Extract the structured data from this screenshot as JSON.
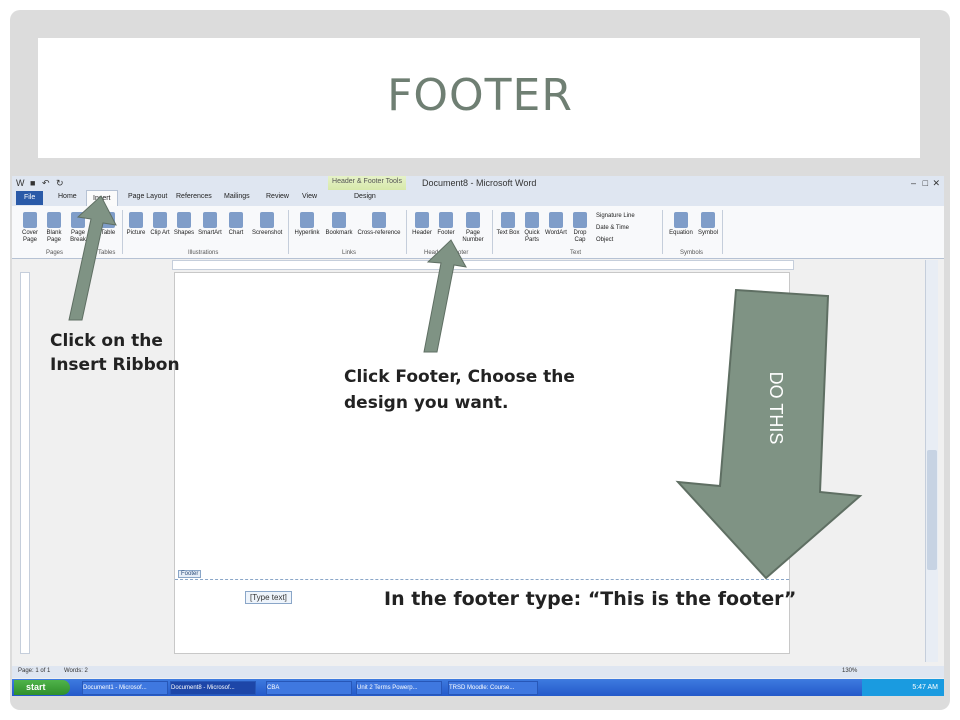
{
  "slide": {
    "title": "FOOTER"
  },
  "word": {
    "window_title": "Document8 - Microsoft Word",
    "contextual_tab": {
      "group": "Header & Footer Tools",
      "tab": "Design"
    },
    "tabs": [
      "File",
      "Home",
      "Insert",
      "Page Layout",
      "References",
      "Mailings",
      "Review",
      "View"
    ],
    "ribbon": {
      "buttons": [
        {
          "label": "Cover Page",
          "icon": "cover-page-icon"
        },
        {
          "label": "Blank Page",
          "icon": "blank-page-icon"
        },
        {
          "label": "Page Break",
          "icon": "page-break-icon"
        },
        {
          "label": "Table",
          "icon": "table-icon"
        },
        {
          "label": "Picture",
          "icon": "picture-icon"
        },
        {
          "label": "Clip Art",
          "icon": "clip-art-icon"
        },
        {
          "label": "Shapes",
          "icon": "shapes-icon"
        },
        {
          "label": "SmartArt",
          "icon": "smartart-icon"
        },
        {
          "label": "Chart",
          "icon": "chart-icon"
        },
        {
          "label": "Screenshot",
          "icon": "screenshot-icon"
        },
        {
          "label": "Hyperlink",
          "icon": "hyperlink-icon"
        },
        {
          "label": "Bookmark",
          "icon": "bookmark-icon"
        },
        {
          "label": "Cross-reference",
          "icon": "cross-reference-icon"
        },
        {
          "label": "Header",
          "icon": "header-icon"
        },
        {
          "label": "Footer",
          "icon": "footer-icon"
        },
        {
          "label": "Page Number",
          "icon": "page-number-icon"
        },
        {
          "label": "Text Box",
          "icon": "text-box-icon"
        },
        {
          "label": "Quick Parts",
          "icon": "quick-parts-icon"
        },
        {
          "label": "WordArt",
          "icon": "wordart-icon"
        },
        {
          "label": "Drop Cap",
          "icon": "drop-cap-icon"
        },
        {
          "label": "Equation",
          "icon": "equation-icon"
        },
        {
          "label": "Symbol",
          "icon": "symbol-icon"
        }
      ],
      "small_items": [
        "Signature Line",
        "Date & Time",
        "Object"
      ],
      "groups": [
        "Pages",
        "Tables",
        "Illustrations",
        "Links",
        "Header & Footer",
        "Text",
        "Symbols"
      ]
    },
    "document": {
      "footer_label": "Footer",
      "footer_placeholder": "[Type text]"
    },
    "status": {
      "page": "Page: 1 of 1",
      "words": "Words: 2",
      "zoom": "130%"
    },
    "taskbar": {
      "start": "start",
      "items": [
        "Document1 - Microsof...",
        "Document8 - Microsof...",
        "CBA",
        "Unit 2 Terms Powerp...",
        "TRSD Moodle: Course..."
      ],
      "clock": "5:47 AM"
    }
  },
  "callouts": {
    "insert": "Click on the Insert Ribbon",
    "footer": "Click Footer, Choose the design you want.",
    "type": "In the footer type: “This is the footer”",
    "do_this": "DO THIS"
  },
  "colors": {
    "title": "#6f7f73",
    "arrow": "#7f9384",
    "accent": "#2a5aa8"
  }
}
